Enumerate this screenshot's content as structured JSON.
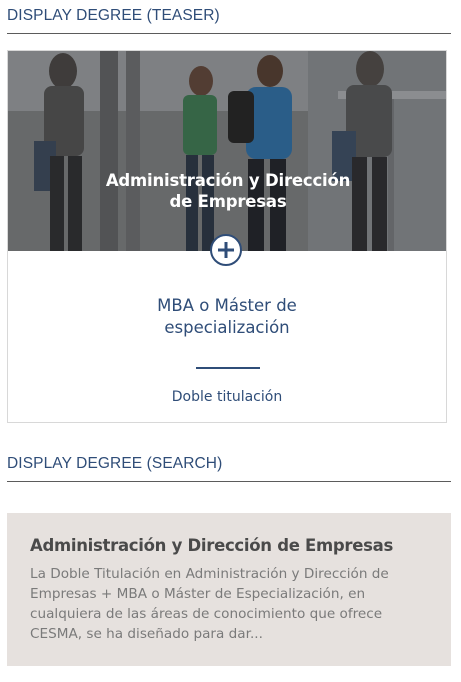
{
  "sections": {
    "teaser_heading": "DISPLAY DEGREE (TEASER)",
    "search_heading": "DISPLAY DEGREE (SEARCH)"
  },
  "teaser": {
    "title_line1": "Administración y Dirección",
    "title_line2": "de Empresas",
    "subtitle_line1": "MBA o Máster de",
    "subtitle_line2": "especialización",
    "link_label": "Doble titulación",
    "plus_icon": "plus-circle-icon"
  },
  "search_result": {
    "title": "Administración y Dirección de Empresas",
    "excerpt_lines": [
      "La Doble Titulación en Administración y Dirección de",
      "Empresas + MBA o Máster de Especialización, en",
      "cualquiera de las áreas de conocimiento que ofrece",
      "CESMA, se ha diseñado para dar..."
    ]
  },
  "colors": {
    "primary": "#2f4d78",
    "search_card_bg": "#e6e1de",
    "excerpt_text": "#7a7a7a",
    "search_title": "#4a4a4a"
  }
}
